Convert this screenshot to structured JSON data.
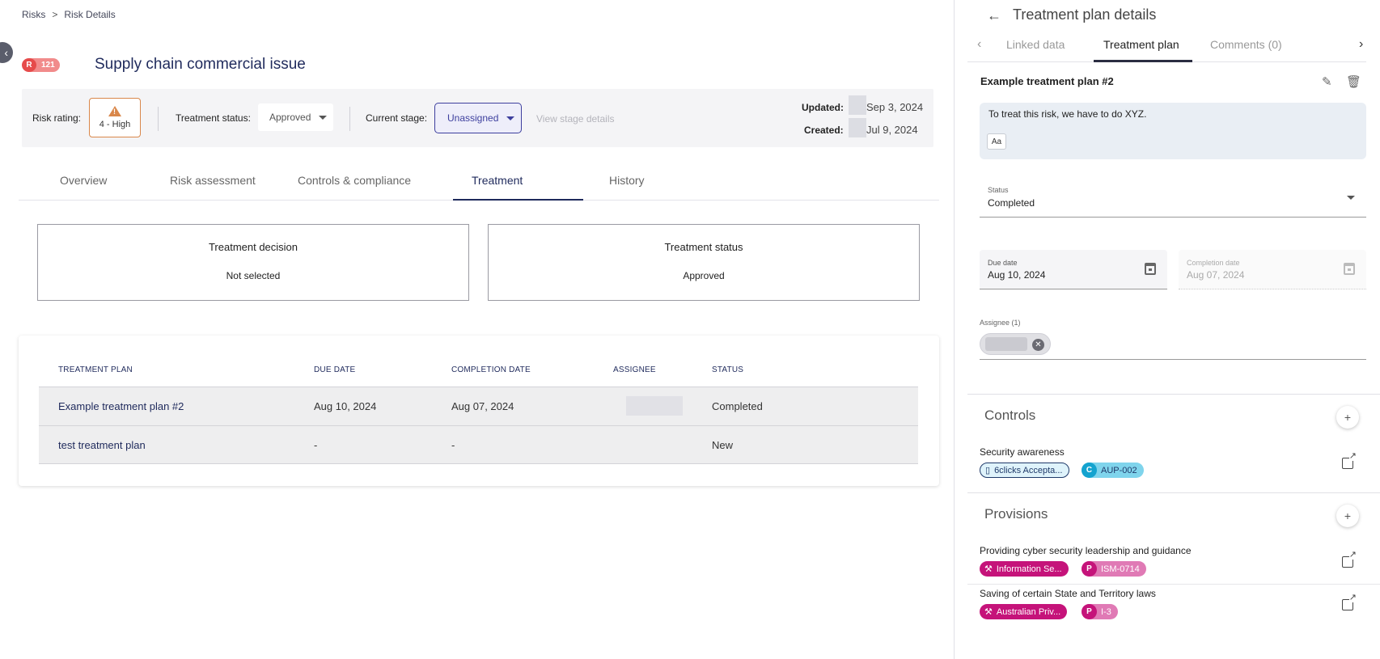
{
  "breadcrumb": {
    "root": "Risks",
    "separator": ">",
    "current": "Risk Details"
  },
  "risk": {
    "badge_letter": "R",
    "badge_number": "121",
    "title": "Supply chain commercial issue"
  },
  "status_bar": {
    "risk_rating_label": "Risk rating:",
    "risk_rating_value": "4 - High",
    "treatment_status_label": "Treatment status:",
    "treatment_status_value": "Approved",
    "current_stage_label": "Current stage:",
    "current_stage_value": "Unassigned",
    "view_stage_link": "View stage details",
    "updated_label": "Updated:",
    "updated_value": "Sep 3, 2024",
    "created_label": "Created:",
    "created_value": "Jul 9, 2024"
  },
  "tabs": [
    "Overview",
    "Risk assessment",
    "Controls & compliance",
    "Treatment",
    "History"
  ],
  "active_tab": "Treatment",
  "cards": {
    "decision_title": "Treatment decision",
    "decision_value": "Not selected",
    "status_title": "Treatment status",
    "status_value": "Approved"
  },
  "table": {
    "headers": [
      "TREATMENT PLAN",
      "DUE DATE",
      "COMPLETION DATE",
      "ASSIGNEE",
      "STATUS"
    ],
    "rows": [
      {
        "plan": "Example treatment plan #2",
        "due": "Aug 10, 2024",
        "completion": "Aug 07, 2024",
        "assignee": "",
        "status": "Completed"
      },
      {
        "plan": "test treatment plan",
        "due": "-",
        "completion": "-",
        "assignee": "",
        "status": "New"
      }
    ]
  },
  "panel": {
    "title": "Treatment plan details",
    "tabs": [
      "Linked data",
      "Treatment plan",
      "Comments (0)"
    ],
    "active_tab": "Treatment plan",
    "plan_name": "Example treatment plan #2",
    "description": "To treat this risk, we have to do XYZ.",
    "format_button": "Aa",
    "status_label": "Status",
    "status_value": "Completed",
    "due_date_label": "Due date",
    "due_date_value": "Aug 10, 2024",
    "completion_date_label": "Completion date",
    "completion_date_value": "Aug 07, 2024",
    "assignee_label": "Assignee (1)",
    "controls_title": "Controls",
    "controls": [
      {
        "name": "Security awareness",
        "doc_tag": "6clicks Accepta...",
        "ctrl_letter": "C",
        "ctrl_tag": "AUP-002"
      }
    ],
    "provisions_title": "Provisions",
    "provisions": [
      {
        "name": "Providing cyber security leadership and guidance",
        "reg_tag": "Information Se...",
        "prov_letter": "P",
        "prov_tag": "ISM-0714"
      },
      {
        "name": "Saving of certain State and Territory laws",
        "reg_tag": "Australian Priv...",
        "prov_letter": "P",
        "prov_tag": "I-3"
      }
    ]
  },
  "colors": {
    "primary": "#1f2a5c",
    "risk_red": "#e64b4b",
    "rating_orange": "#d9874a",
    "control_cyan": "#14a3cf",
    "regulation_magenta": "#c5137a"
  }
}
